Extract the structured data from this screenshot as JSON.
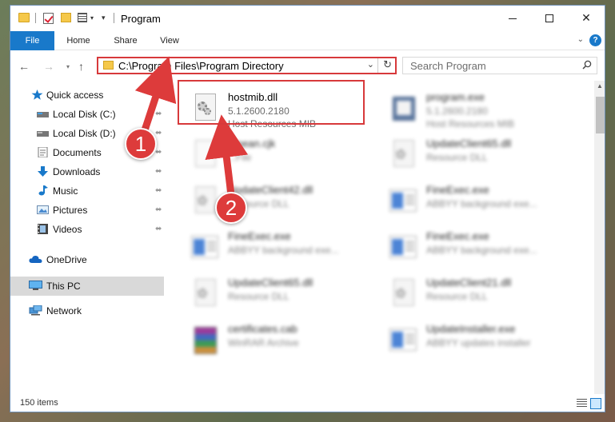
{
  "window": {
    "title": "Program"
  },
  "ribbon": {
    "file": "File",
    "home": "Home",
    "share": "Share",
    "view": "View",
    "help": "?"
  },
  "nav": {
    "back_arrow": "←",
    "forward_arrow": "→",
    "up_arrow": "↑",
    "address_path": "C:\\Program Files\\Program Directory",
    "refresh_glyph": "↻",
    "search_placeholder": "Search Program"
  },
  "sidebar": {
    "items": [
      {
        "label": "Quick access",
        "icon": "star-icon",
        "pinned": false
      },
      {
        "label": "Local Disk (C:)",
        "icon": "drive-icon",
        "pinned": true
      },
      {
        "label": "Local Disk (D:)",
        "icon": "drive-icon",
        "pinned": true
      },
      {
        "label": "Documents",
        "icon": "documents-icon",
        "pinned": true
      },
      {
        "label": "Downloads",
        "icon": "download-icon",
        "pinned": true
      },
      {
        "label": "Music",
        "icon": "music-icon",
        "pinned": true
      },
      {
        "label": "Pictures",
        "icon": "pictures-icon",
        "pinned": true
      },
      {
        "label": "Videos",
        "icon": "videos-icon",
        "pinned": true
      },
      {
        "label": "OneDrive",
        "icon": "cloud-icon",
        "pinned": false
      },
      {
        "label": "This PC",
        "icon": "computer-icon",
        "pinned": false
      },
      {
        "label": "Network",
        "icon": "network-icon",
        "pinned": false
      }
    ],
    "pin_glyph": "📌"
  },
  "files": [
    {
      "name": "hostmib.dll",
      "meta1": "5.1.2600.2180",
      "meta2": "Host Resources MIB",
      "icon": "dll-gear-icon",
      "selected": true
    },
    {
      "name": "program.exe",
      "meta1": "5.1.2600.2180",
      "meta2": "Host Resources MIB",
      "icon": "exe-icon"
    },
    {
      "name": "...nean.cjk",
      "meta1": "...File",
      "meta2": "",
      "icon": "blank-file-icon"
    },
    {
      "name": "UpdateClient65.dll",
      "meta1": "Resource DLL",
      "meta2": "",
      "icon": "dll-gear-icon"
    },
    {
      "name": "UpdateClient42.dll",
      "meta1": "Resource DLL",
      "meta2": "",
      "icon": "dll-gear-icon"
    },
    {
      "name": "FineExec.exe",
      "meta1": "ABBYY background exe...",
      "meta2": "",
      "icon": "window-app-icon"
    },
    {
      "name": "FineExec.exe",
      "meta1": "ABBYY background exe...",
      "meta2": "",
      "icon": "window-app-icon"
    },
    {
      "name": "FineExec.exe",
      "meta1": "ABBYY background exe...",
      "meta2": "",
      "icon": "window-app-icon"
    },
    {
      "name": "UpdateClient65.dll",
      "meta1": "Resource DLL",
      "meta2": "",
      "icon": "dll-gear-icon"
    },
    {
      "name": "UpdateClient21.dll",
      "meta1": "Resource DLL",
      "meta2": "",
      "icon": "dll-gear-icon"
    },
    {
      "name": "certificates.cab",
      "meta1": "WinRAR Archive",
      "meta2": "",
      "icon": "rar-icon"
    },
    {
      "name": "UpdateInstaller.exe",
      "meta1": "ABBYY updates installer",
      "meta2": "",
      "icon": "window-app-icon"
    }
  ],
  "status": {
    "count": "150 items"
  },
  "annotations": {
    "badge1": "1",
    "badge2": "2",
    "color": "#dd3b3b"
  },
  "colors": {
    "accent": "#1979ca",
    "selection_highlight": "#d7393b"
  }
}
